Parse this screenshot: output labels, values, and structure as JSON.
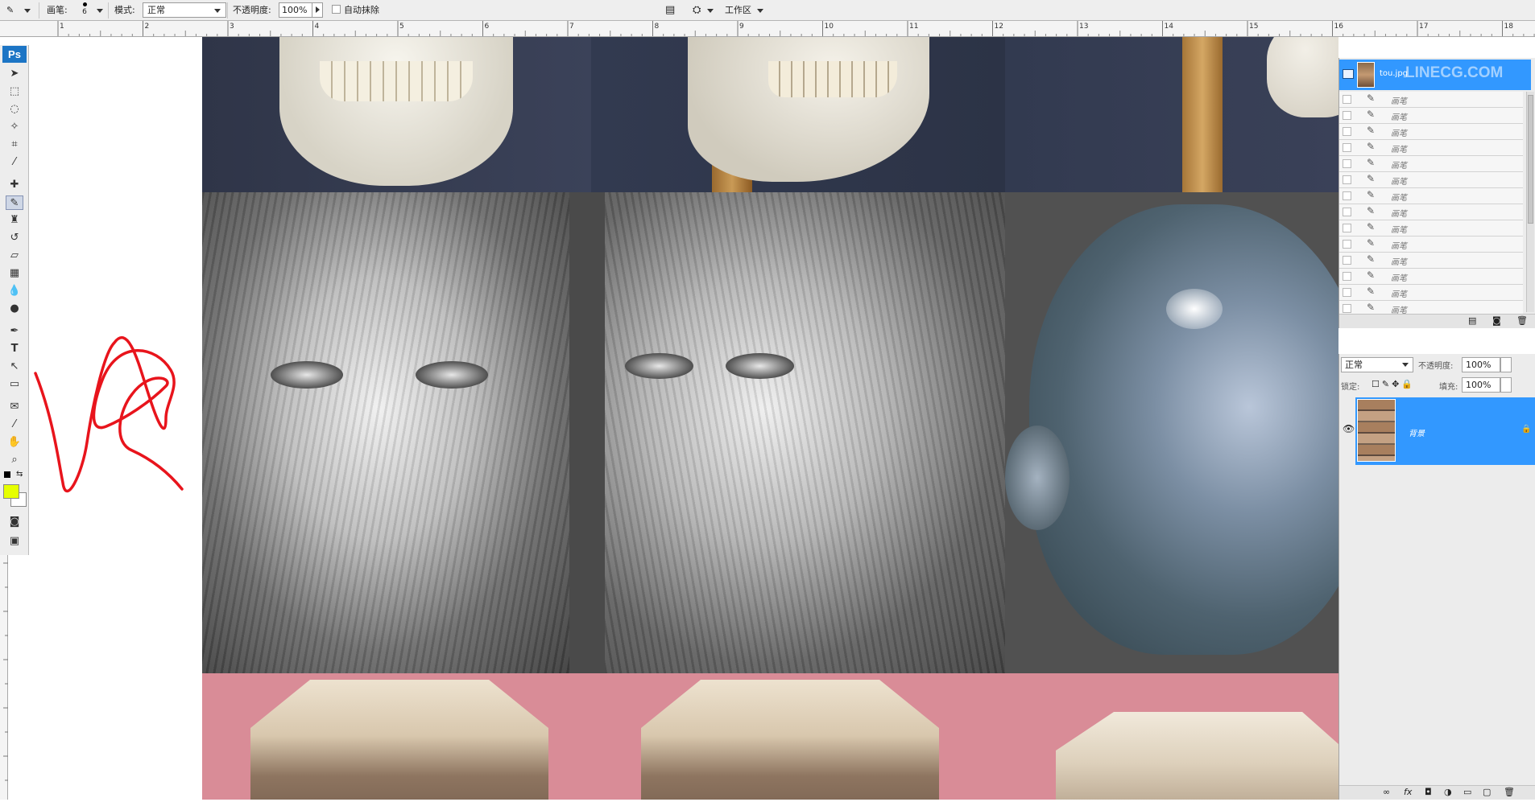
{
  "options_bar": {
    "brush_label": "画笔:",
    "brush_size": "6",
    "mode_label": "模式:",
    "mode_value": "正常",
    "opacity_label": "不透明度:",
    "opacity_value": "100%",
    "auto_erase_label": "自动抹除",
    "workspace_label": "工作区"
  },
  "ruler": {
    "marks": [
      "1",
      "2",
      "3",
      "4",
      "5",
      "6",
      "7",
      "8",
      "9",
      "10",
      "11",
      "12",
      "13",
      "14",
      "15",
      "16",
      "17",
      "18"
    ]
  },
  "tools": {
    "logo": "Ps",
    "foreground_color": "#e6ff00",
    "background_color": "#ffffff"
  },
  "history_panel": {
    "snapshot_name": "tou.jpg",
    "watermark": "LINECG.COM",
    "item_label": "画笔",
    "item_count": 14
  },
  "layers_panel": {
    "blend_mode": "正常",
    "opacity_label": "不透明度:",
    "opacity_value": "100%",
    "lock_label": "锁定:",
    "fill_label": "填充:",
    "fill_value": "100%",
    "layer_name": "背景"
  },
  "colors": {
    "selection_blue": "#3298ff",
    "scribble_red": "#e8141c"
  }
}
